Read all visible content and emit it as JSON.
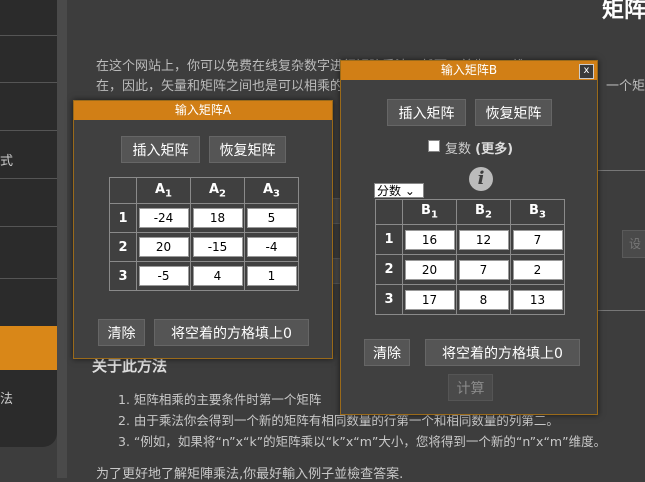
{
  "page": {
    "title": "矩阵",
    "intro_line1": "在这个网站上，你可以免费在线复杂数字进行矩阵乘法。然而，首先，一维",
    "intro_line2": "在，因此，矢量和矩阵之间也是可以相乘的",
    "intro_line2_tail": "一个矩",
    "about_heading": "关于此方法",
    "about_items": [
      "1. 矩阵相乘的主要条件时第一个矩阵",
      "2. 由于乘法你会得到一个新的矩阵有相同数量的行第一个和相同数量的列第二。",
      "3. “例如，如果将“n”x“k”的矩阵乘以“k”x“m”大小，您将得到一个新的“n”x“m”维度。"
    ],
    "footer": "为了更好地了解矩陣乘法,你最好輸入例子並檢查答案.",
    "sidebar_chars": [
      "式",
      "法"
    ],
    "peek_button": "设"
  },
  "dialog_a": {
    "title": "输入矩阵A",
    "insert_label": "插入矩阵",
    "restore_label": "恢复矩阵",
    "col_headers": [
      {
        "letter": "A",
        "sub": "1"
      },
      {
        "letter": "A",
        "sub": "2"
      },
      {
        "letter": "A",
        "sub": "3"
      }
    ],
    "row_headers": [
      "1",
      "2",
      "3"
    ],
    "cells": [
      [
        "-24",
        "18",
        "5"
      ],
      [
        "20",
        "-15",
        "-4"
      ],
      [
        "-5",
        "4",
        "1"
      ]
    ],
    "clear_label": "清除",
    "fill_zero_label": "将空着的方格填上0"
  },
  "dialog_b": {
    "title": "输入矩阵B",
    "close_label": "x",
    "insert_label": "插入矩阵",
    "restore_label": "恢复矩阵",
    "complex_label": "复数",
    "more_label": "(更多)",
    "format_select": "分数",
    "col_headers": [
      {
        "letter": "B",
        "sub": "1"
      },
      {
        "letter": "B",
        "sub": "2"
      },
      {
        "letter": "B",
        "sub": "3"
      }
    ],
    "row_headers": [
      "1",
      "2",
      "3"
    ],
    "cells": [
      [
        "16",
        "12",
        "7"
      ],
      [
        "20",
        "7",
        "2"
      ],
      [
        "17",
        "8",
        "13"
      ]
    ],
    "clear_label": "清除",
    "fill_zero_label": "将空着的方格填上0",
    "compute_label": "计算"
  },
  "colors": {
    "accent": "#d17f16",
    "background": "#3d3d3d",
    "sidebar": "#2b2b2b"
  }
}
